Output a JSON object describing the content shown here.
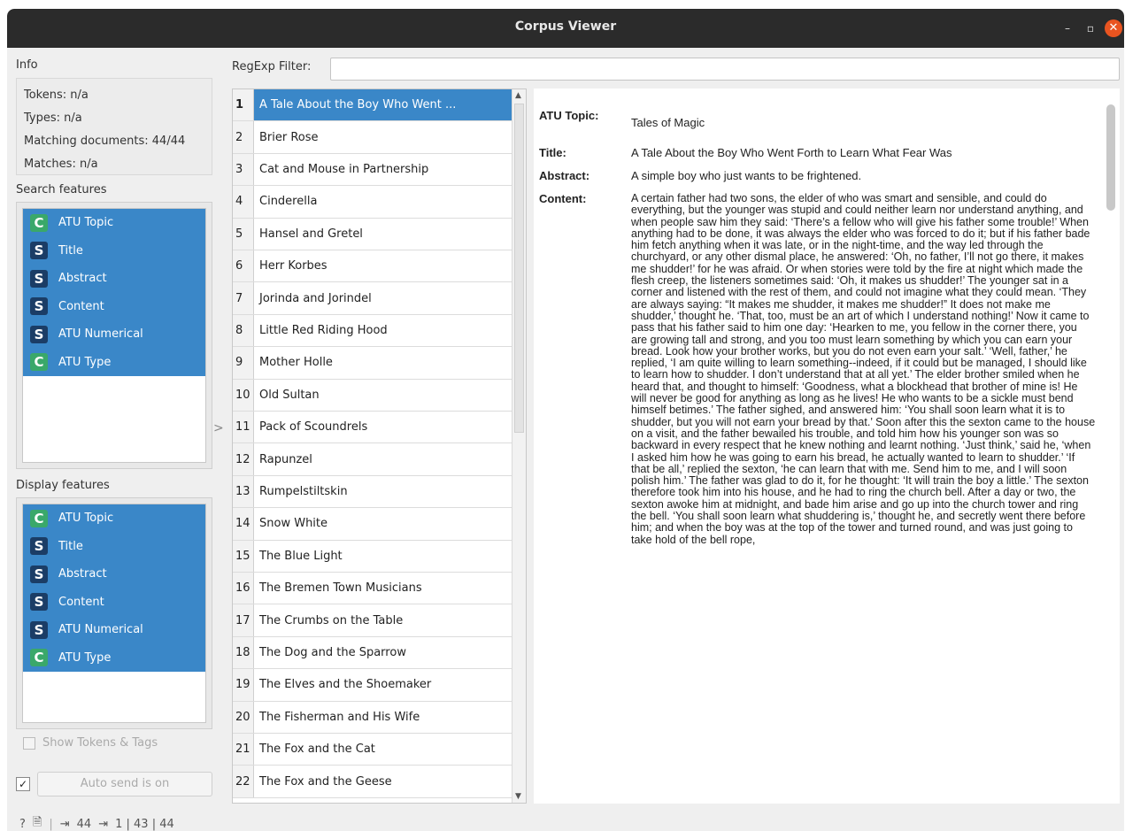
{
  "window": {
    "title": "Corpus Viewer",
    "min_glyph": "–",
    "max_glyph": "▫",
    "close_glyph": "✕"
  },
  "info": {
    "label": "Info",
    "tokens": "Tokens: n/a",
    "types": "Types: n/a",
    "matching": "Matching documents: 44/44",
    "matches": "Matches: n/a"
  },
  "search_features": {
    "label": "Search features",
    "items": [
      {
        "badge": "C",
        "label": "ATU Topic"
      },
      {
        "badge": "S",
        "label": "Title"
      },
      {
        "badge": "S",
        "label": "Abstract"
      },
      {
        "badge": "S",
        "label": "Content"
      },
      {
        "badge": "S",
        "label": "ATU Numerical"
      },
      {
        "badge": "C",
        "label": "ATU Type"
      }
    ]
  },
  "display_features": {
    "label": "Display features",
    "items": [
      {
        "badge": "C",
        "label": "ATU Topic"
      },
      {
        "badge": "S",
        "label": "Title"
      },
      {
        "badge": "S",
        "label": "Abstract"
      },
      {
        "badge": "S",
        "label": "Content"
      },
      {
        "badge": "S",
        "label": "ATU Numerical"
      },
      {
        "badge": "C",
        "label": "ATU Type"
      }
    ]
  },
  "show_tokens": "Show Tokens & Tags",
  "auto_send": {
    "checked": "✓",
    "label": "Auto send is on"
  },
  "status": {
    "help": "?",
    "doc": "🗎",
    "in_icon": "⇥",
    "in_count": "44",
    "out_icon": "⇥",
    "out_counts": "1 | 43 | 44"
  },
  "regex": {
    "label": "RegExp Filter:",
    "value": ""
  },
  "documents": [
    {
      "n": "1",
      "title": "A Tale About the Boy Who Went ..."
    },
    {
      "n": "2",
      "title": "Brier Rose"
    },
    {
      "n": "3",
      "title": "Cat and Mouse in Partnership"
    },
    {
      "n": "4",
      "title": "Cinderella"
    },
    {
      "n": "5",
      "title": "Hansel and Gretel"
    },
    {
      "n": "6",
      "title": "Herr Korbes"
    },
    {
      "n": "7",
      "title": "Jorinda and Jorindel"
    },
    {
      "n": "8",
      "title": "Little Red Riding Hood"
    },
    {
      "n": "9",
      "title": "Mother Holle"
    },
    {
      "n": "10",
      "title": "Old Sultan"
    },
    {
      "n": "11",
      "title": "Pack of Scoundrels"
    },
    {
      "n": "12",
      "title": "Rapunzel"
    },
    {
      "n": "13",
      "title": "Rumpelstiltskin"
    },
    {
      "n": "14",
      "title": "Snow White"
    },
    {
      "n": "15",
      "title": "The Blue Light"
    },
    {
      "n": "16",
      "title": "The Bremen Town Musicians"
    },
    {
      "n": "17",
      "title": "The Crumbs on the Table"
    },
    {
      "n": "18",
      "title": "The Dog and the Sparrow"
    },
    {
      "n": "19",
      "title": "The Elves and the Shoemaker"
    },
    {
      "n": "20",
      "title": "The Fisherman and His Wife"
    },
    {
      "n": "21",
      "title": "The Fox and the Cat"
    },
    {
      "n": "22",
      "title": "The Fox and the Geese"
    }
  ],
  "selected_doc": 0,
  "doc_detail": {
    "atu_topic_key": "ATU Topic:",
    "atu_topic": "Tales of Magic",
    "title_key": "Title:",
    "title": "A Tale About the Boy Who Went Forth to Learn What Fear Was",
    "abstract_key": "Abstract:",
    "abstract": "A simple boy who just wants to be frightened.",
    "content_key": "Content:",
    "content": "A certain father had two sons, the elder of who was smart and sensible, and could do everything, but the younger was stupid and could neither learn nor understand anything, and when people saw him they said: ‘There’s a fellow who will give his father some trouble!’ When anything had to be done, it was always the elder who was forced to do it; but if his father bade him fetch anything when it was late, or in the night-time, and the way led through the churchyard, or any other dismal place, he answered: ‘Oh, no father, I’ll not go there, it makes me shudder!’ for he was afraid. Or when stories were told by the fire at night which made the flesh creep, the listeners sometimes said: ‘Oh, it makes us shudder!’ The younger sat in a corner and listened with the rest of them, and could not imagine what they could mean. ‘They are always saying: “It makes me shudder, it makes me shudder!” It does not make me shudder,’ thought he. ‘That, too, must be an art of which I understand nothing!’ Now it came to pass that his father said to him one day: ‘Hearken to me, you fellow in the corner there, you are growing tall and strong, and you too must learn something by which you can earn your bread. Look how your brother works, but you do not even earn your salt.’ ‘Well, father,’ he replied, ‘I am quite willing to learn something--indeed, if it could but be managed, I should like to learn how to shudder. I don’t understand that at all yet.’ The elder brother smiled when he heard that, and thought to himself: ‘Goodness, what a blockhead that brother of mine is! He will never be good for anything as long as he lives! He who wants to be a sickle must bend himself betimes.’ The father sighed, and answered him: ‘You shall soon learn what it is to shudder, but you will not earn your bread by that.’ Soon after this the sexton came to the house on a visit, and the father bewailed his trouble, and told him how his younger son was so backward in every respect that he knew nothing and learnt nothing. ‘Just think,’ said he, ‘when I asked him how he was going to earn his bread, he actually wanted to learn to shudder.’ ‘If that be all,’ replied the sexton, ‘he can learn that with me. Send him to me, and I will soon polish him.’ The father was glad to do it, for he thought: ‘It will train the boy a little.’ The sexton therefore took him into his house, and he had to ring the church bell. After a day or two, the sexton awoke him at midnight, and bade him arise and go up into the church tower and ring the bell. ‘You shall soon learn what shuddering is,’ thought he, and secretly went there before him; and when the boy was at the top of the tower and turned round, and was just going to take hold of the bell rope,"
  }
}
